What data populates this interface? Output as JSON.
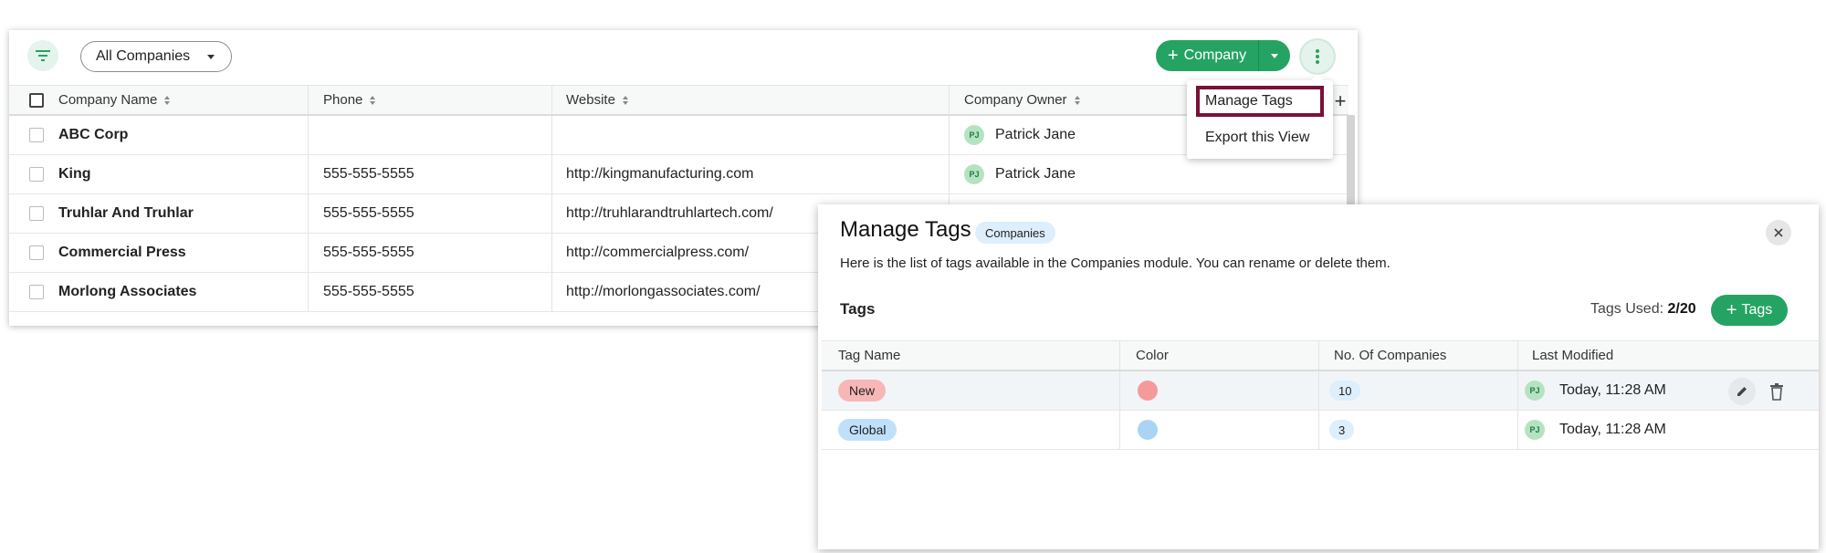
{
  "list": {
    "view_select": "All Companies",
    "add_company_label": "Company",
    "columns": [
      "Company Name",
      "Phone",
      "Website",
      "Company Owner"
    ],
    "rows": [
      {
        "name": "ABC Corp",
        "phone": "",
        "website": "",
        "owner_initials": "PJ",
        "owner": "Patrick Jane"
      },
      {
        "name": "King",
        "phone": "555-555-5555",
        "website": "http://kingmanufacturing.com",
        "owner_initials": "PJ",
        "owner": "Patrick Jane"
      },
      {
        "name": "Truhlar And Truhlar",
        "phone": "555-555-5555",
        "website": "http://truhlarandtruhlartech.com/",
        "owner_initials": "",
        "owner": ""
      },
      {
        "name": "Commercial Press",
        "phone": "555-555-5555",
        "website": "http://commercialpress.com/",
        "owner_initials": "",
        "owner": ""
      },
      {
        "name": "Morlong Associates",
        "phone": "555-555-5555",
        "website": "http://morlongassociates.com/",
        "owner_initials": "",
        "owner": ""
      }
    ],
    "accent_color": "#25a363"
  },
  "menu": {
    "items": [
      "Manage Tags",
      "Export this View"
    ],
    "highlight_color": "#7a1038"
  },
  "modal": {
    "title": "Manage Tags",
    "module_chip": "Companies",
    "description": "Here is the list of tags available in the Companies module. You can rename or delete them.",
    "tags_heading": "Tags",
    "tags_used_label": "Tags Used:",
    "tags_used_value": "2/20",
    "add_tags_label": "Tags",
    "columns": [
      "Tag Name",
      "Color",
      "No. Of Companies",
      "Last Modified"
    ],
    "rows": [
      {
        "tag": "New",
        "tag_bg": "#f7b7b7",
        "dot_color": "#f59a9a",
        "count": "10",
        "initials": "PJ",
        "modified": "Today, 11:28 AM"
      },
      {
        "tag": "Global",
        "tag_bg": "#bfe0fb",
        "dot_color": "#a9d4f6",
        "count": "3",
        "initials": "PJ",
        "modified": "Today, 11:28 AM"
      }
    ]
  }
}
